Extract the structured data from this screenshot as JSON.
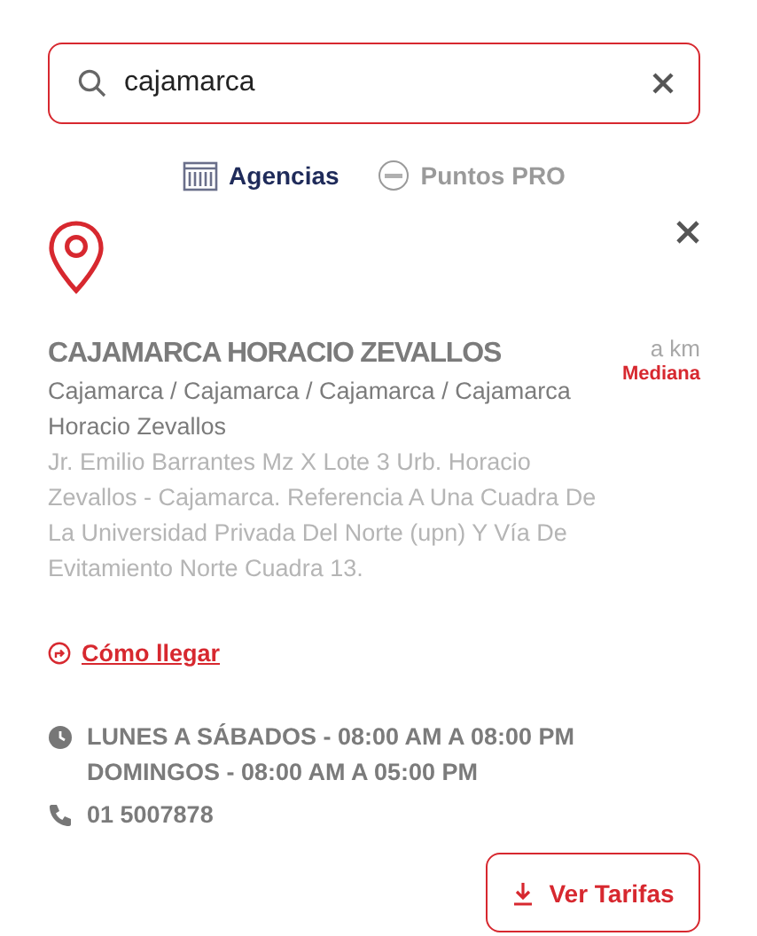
{
  "search": {
    "value": "cajamarca"
  },
  "tabs": [
    {
      "label": "Agencias",
      "kind": "agency",
      "selected": true
    },
    {
      "label": "Puntos PRO",
      "kind": "pro",
      "selected": false
    }
  ],
  "agency": {
    "name": "CAJAMARCA HORACIO ZEVALLOS",
    "distance": "a km",
    "size": "Mediana",
    "location": "Cajamarca / Cajamarca / Cajamarca / Cajamarca Horacio Zevallos",
    "address": "Jr. Emilio Barrantes Mz X Lote 3 Urb. Horacio Zevallos - Cajamarca. Referencia A Una Cuadra De La Universidad Privada Del Norte (upn) Y Vía De Evitamiento Norte Cuadra 13.",
    "directions": "Cómo llegar",
    "hours": [
      "LUNES A SÁBADOS - 08:00 AM A 08:00 PM",
      "DOMINGOS - 08:00 AM A 05:00 PM"
    ],
    "phone": "01 5007878",
    "button": "Ver Tarifas"
  }
}
